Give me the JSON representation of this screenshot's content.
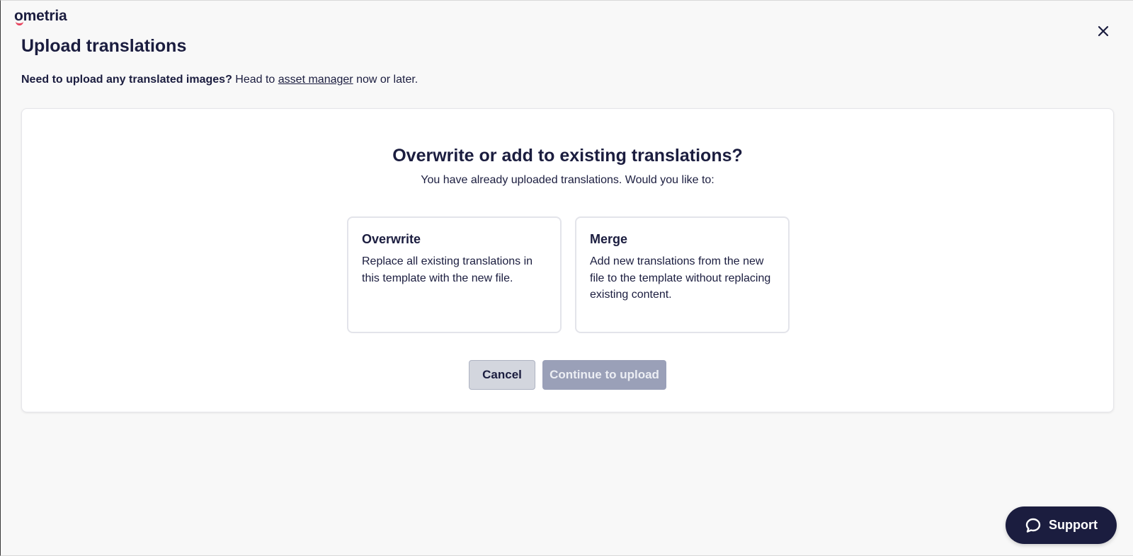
{
  "app": {
    "logo_text": "ometria",
    "accent_color": "#e8455f",
    "brand_color": "#1b1d3f"
  },
  "header": {
    "title": "Upload translations",
    "close_icon": "close-icon"
  },
  "intro": {
    "bold": "Need to upload any translated images?",
    "before_link": " Head to ",
    "link": "asset manager",
    "after_link": " now or later."
  },
  "dialog": {
    "title": "Overwrite or add to existing translations?",
    "subtitle": "You have already uploaded translations. Would you like to:",
    "options": [
      {
        "title": "Overwrite",
        "description": "Replace all existing translations in this template with the new file."
      },
      {
        "title": "Merge",
        "description": "Add new translations from the new file to the template without replacing existing content."
      }
    ],
    "cancel_label": "Cancel",
    "continue_label": "Continue to upload"
  },
  "support": {
    "label": "Support",
    "icon": "chat-bubble-icon"
  }
}
